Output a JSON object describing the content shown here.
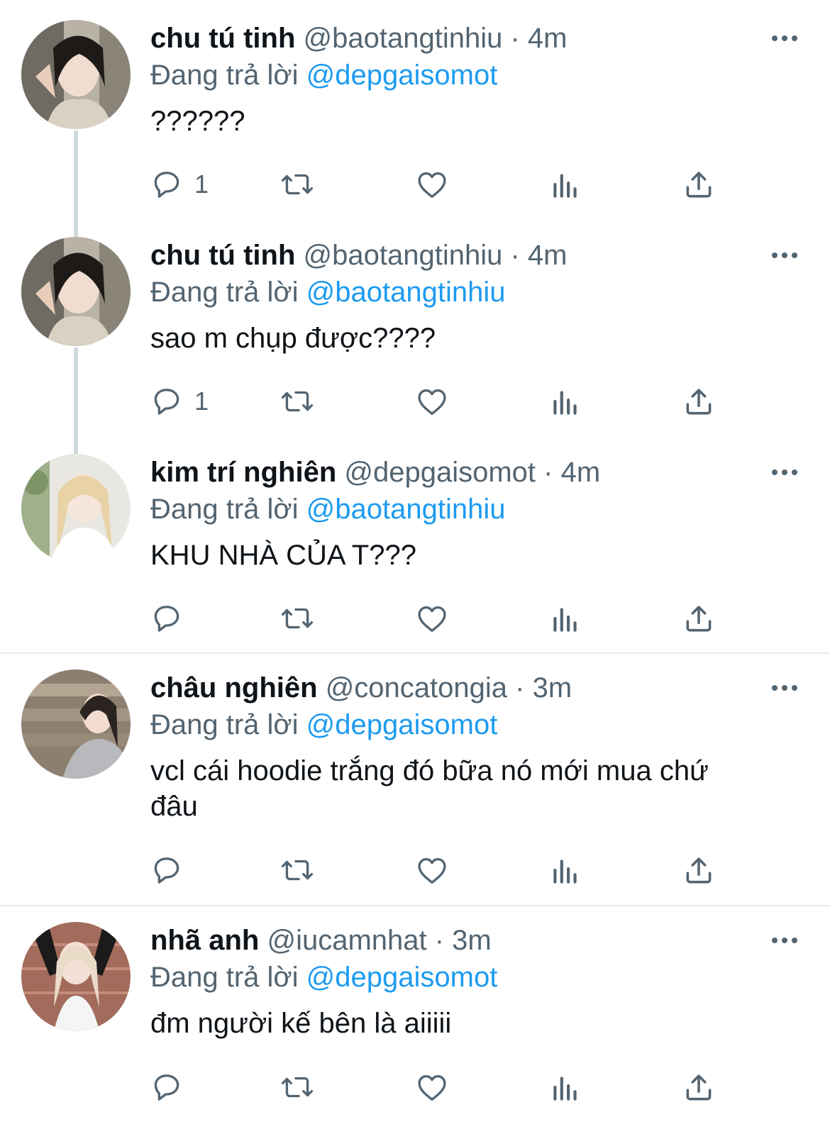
{
  "reply_prefix": "Đang trả lời",
  "tweets": [
    {
      "name": "chu tú tinh",
      "handle": "@baotangtinhiu",
      "separator": " · ",
      "time": "4m",
      "reply_to": "@depgaisomot",
      "text": "??????",
      "reply_count": "1"
    },
    {
      "name": "chu tú tinh",
      "handle": "@baotangtinhiu",
      "separator": " · ",
      "time": "4m",
      "reply_to": "@baotangtinhiu",
      "text": "sao m chụp được????",
      "reply_count": "1"
    },
    {
      "name": "kim trí nghiên",
      "handle": "@depgaisomot",
      "separator": " · ",
      "time": "4m",
      "reply_to": "@baotangtinhiu",
      "text": "KHU NHÀ CỦA T???",
      "reply_count": ""
    },
    {
      "name": "châu nghiên",
      "handle": "@concatongia",
      "separator": " · ",
      "time": "3m",
      "reply_to": "@depgaisomot",
      "text": "vcl cái hoodie trắng đó bữa nó mới mua chứ đâu",
      "reply_count": ""
    },
    {
      "name": "nhã anh",
      "handle": "@iucamnhat",
      "separator": " · ",
      "time": "3m",
      "reply_to": "@depgaisomot",
      "text": "đm người kế bên là aiiiii",
      "reply_count": ""
    }
  ],
  "icons": {
    "reply": "reply-icon",
    "retweet": "retweet-icon",
    "like": "heart-icon",
    "views": "views-icon",
    "share": "share-icon",
    "more": "more-icon"
  },
  "colors": {
    "mention": "#1d9bf0",
    "secondary_text": "#536471",
    "primary_text": "#0f1419",
    "divider": "#e7e9ea",
    "thread_line": "#cfd9de"
  }
}
